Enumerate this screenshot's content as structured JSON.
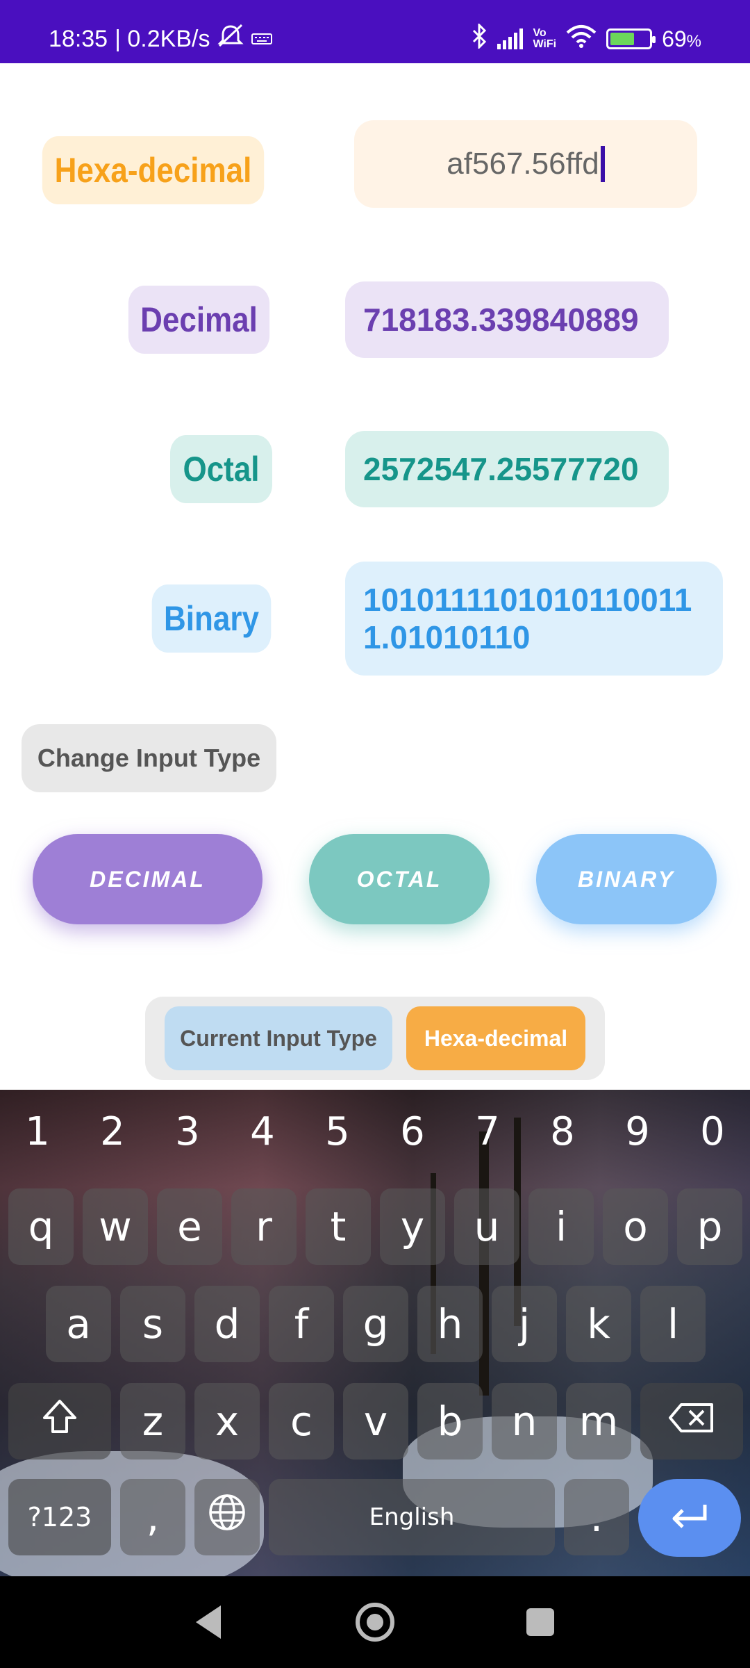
{
  "status_bar": {
    "time": "18:35",
    "net_speed": "| 0.2KB/s",
    "battery": "69",
    "battery_unit": "%",
    "icons": [
      "silent-icon",
      "keyboard-icon",
      "bluetooth-icon",
      "signal-icon",
      "vowifi-icon",
      "wifi-icon",
      "battery-icon"
    ],
    "vowifi_top": "Vo",
    "vowifi_bottom": "WiFi"
  },
  "converter": {
    "hex_label": "Hexa-decimal",
    "hex_input_value": "af567.56ffd",
    "decimal_label": "Decimal",
    "decimal_value": "718183.339840889",
    "octal_label": "Octal",
    "octal_value": "2572547.25577720",
    "binary_label": "Binary",
    "binary_value": "10101111010101100111.01010110"
  },
  "change_input": {
    "label": "Change Input Type",
    "options": [
      "DECIMAL",
      "OCTAL",
      "BINARY"
    ]
  },
  "current_input": {
    "label": "Current Input Type",
    "value": "Hexa-decimal"
  },
  "keyboard": {
    "number_row": [
      "1",
      "2",
      "3",
      "4",
      "5",
      "6",
      "7",
      "8",
      "9",
      "0"
    ],
    "row1": [
      "q",
      "w",
      "e",
      "r",
      "t",
      "y",
      "u",
      "i",
      "o",
      "p"
    ],
    "row2": [
      "a",
      "s",
      "d",
      "f",
      "g",
      "h",
      "j",
      "k",
      "l"
    ],
    "row3": [
      "z",
      "x",
      "c",
      "v",
      "b",
      "n",
      "m"
    ],
    "symbols_key": "?123",
    "comma_key": ",",
    "space_label": "English",
    "period_key": ".",
    "shift_icon": "shift-icon",
    "backspace_icon": "backspace-icon",
    "globe_icon": "globe-icon",
    "enter_icon": "enter-icon"
  },
  "nav_bar": {
    "icons": [
      "back-icon",
      "home-icon",
      "recents-icon"
    ]
  }
}
